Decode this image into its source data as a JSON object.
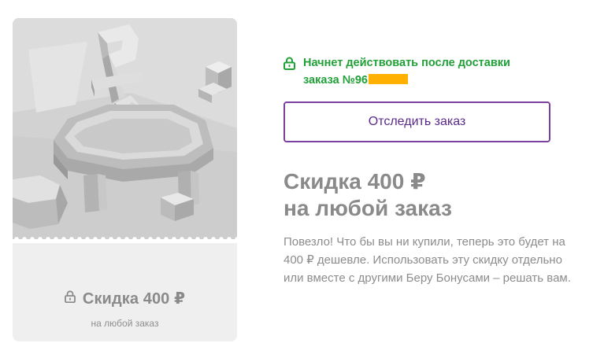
{
  "coupon": {
    "title": "Скидка 400 ₽",
    "subtitle": "на любой заказ",
    "icon": "lock-icon"
  },
  "status": {
    "icon": "lock-icon",
    "color": "#21a038",
    "line1": "Начнет действовать после доставки",
    "line2": "заказа №96"
  },
  "track_button": {
    "label": "Отследить заказ",
    "border_color": "#7b3fa0"
  },
  "headline": {
    "line1": "Скидка 400 ₽",
    "line2": "на любой заказ"
  },
  "description": "Повезло! Что бы вы ни купили, теперь это будет на 400 ₽ дешевле. Использовать эту скидку отдельно или вместе с другими Беру Бонусами – решать вам.",
  "colors": {
    "accent_green": "#21a038",
    "accent_purple": "#7b3fa0",
    "redaction": "#ffb000",
    "muted_text": "#8a8a8a"
  }
}
